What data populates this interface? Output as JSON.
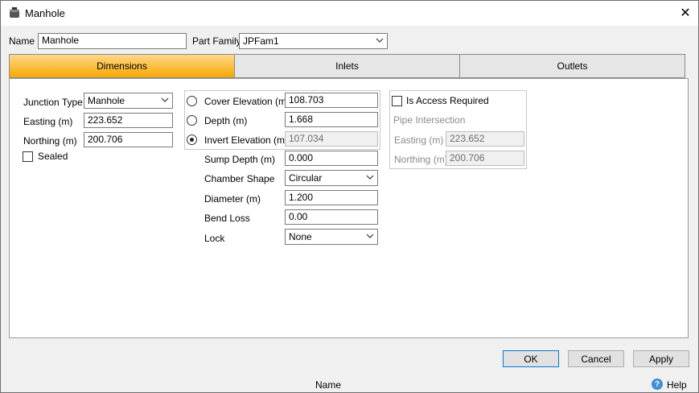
{
  "window": {
    "title": "Manhole"
  },
  "header": {
    "name_label": "Name",
    "name_value": "Manhole",
    "part_family_label": "Part Family",
    "part_family_value": "JPFam1"
  },
  "tabs": [
    {
      "label": "Dimensions",
      "active": true
    },
    {
      "label": "Inlets",
      "active": false
    },
    {
      "label": "Outlets",
      "active": false
    }
  ],
  "left": {
    "junction_type_label": "Junction Type",
    "junction_type_value": "Manhole",
    "easting_label": "Easting (m)",
    "easting_value": "223.652",
    "northing_label": "Northing (m)",
    "northing_value": "200.706",
    "sealed_label": "Sealed"
  },
  "middle": {
    "cover_elevation_label": "Cover Elevation (m)",
    "cover_elevation_value": "108.703",
    "depth_label": "Depth (m)",
    "depth_value": "1.668",
    "invert_elevation_label": "Invert Elevation (m)",
    "invert_elevation_value": "107.034",
    "sump_depth_label": "Sump Depth (m)",
    "sump_depth_value": "0.000",
    "chamber_shape_label": "Chamber Shape",
    "chamber_shape_value": "Circular",
    "diameter_label": "Diameter (m)",
    "diameter_value": "1.200",
    "bend_loss_label": "Bend Loss",
    "bend_loss_value": "0.00",
    "lock_label": "Lock",
    "lock_value": "None"
  },
  "access": {
    "is_access_required_label": "Is Access Required",
    "pipe_intersection_label": "Pipe Intersection",
    "easting_label": "Easting (m)",
    "easting_value": "223.652",
    "northing_label": "Northing (m)",
    "northing_value": "200.706"
  },
  "buttons": {
    "ok": "OK",
    "cancel": "Cancel",
    "apply": "Apply"
  },
  "status": {
    "name": "Name",
    "help": "Help"
  },
  "colors": {
    "active_tab_top": "#ffd88a",
    "active_tab_bottom": "#f7a800",
    "focus": "#0078d7"
  },
  "icons": {
    "title": "manhole-icon",
    "close": "close-icon",
    "help": "help-icon"
  }
}
